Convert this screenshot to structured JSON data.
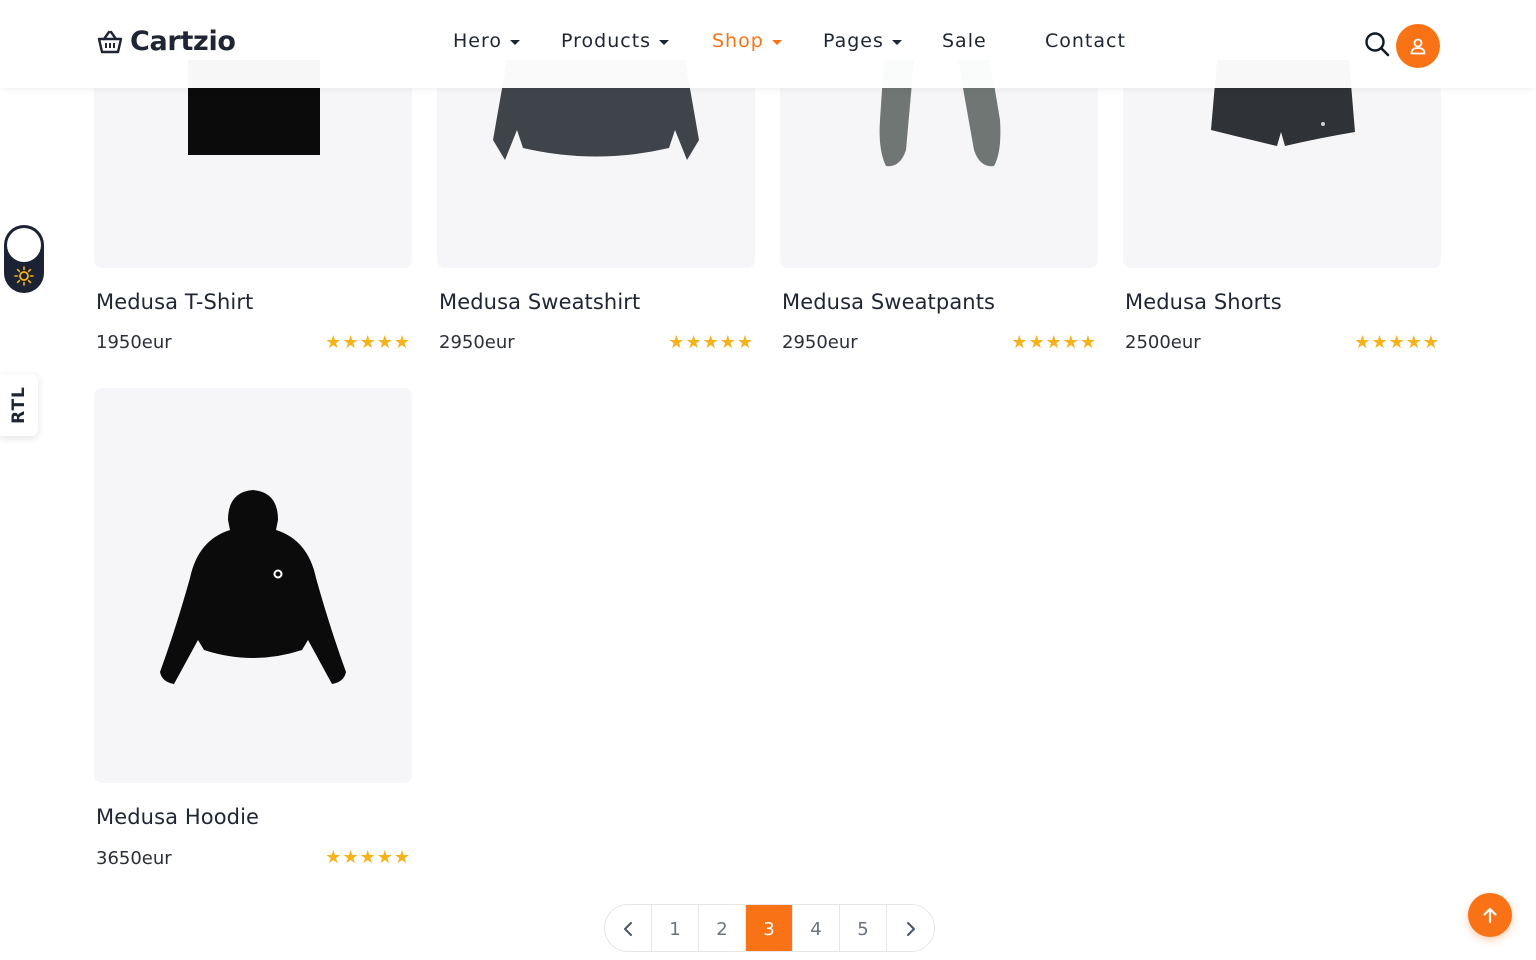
{
  "brand": {
    "name": "Cartzio",
    "accent_color": "#f97316"
  },
  "nav": {
    "items": [
      {
        "label": "Hero",
        "has_dropdown": true,
        "active": false
      },
      {
        "label": "Products",
        "has_dropdown": true,
        "active": false
      },
      {
        "label": "Shop",
        "has_dropdown": true,
        "active": true
      },
      {
        "label": "Pages",
        "has_dropdown": true,
        "active": false
      },
      {
        "label": "Sale",
        "has_dropdown": false,
        "active": false
      },
      {
        "label": "Contact",
        "has_dropdown": false,
        "active": false
      }
    ],
    "icons": {
      "search": "search-icon",
      "account": "user-icon"
    }
  },
  "side": {
    "rtl_label": "RTL",
    "theme_toggle_icon": "sun-icon"
  },
  "products": [
    {
      "name": "Medusa T-Shirt",
      "price": "1950eur",
      "rating": 5
    },
    {
      "name": "Medusa Sweatshirt",
      "price": "2950eur",
      "rating": 5
    },
    {
      "name": "Medusa Sweatpants",
      "price": "2950eur",
      "rating": 5
    },
    {
      "name": "Medusa Shorts",
      "price": "2500eur",
      "rating": 5
    },
    {
      "name": "Medusa Hoodie",
      "price": "3650eur",
      "rating": 5
    }
  ],
  "pagination": {
    "prev_icon": "chevron-left-icon",
    "next_icon": "chevron-right-icon",
    "pages": [
      "1",
      "2",
      "3",
      "4",
      "5"
    ],
    "current": "3"
  },
  "scroll_top_icon": "arrow-up-icon"
}
